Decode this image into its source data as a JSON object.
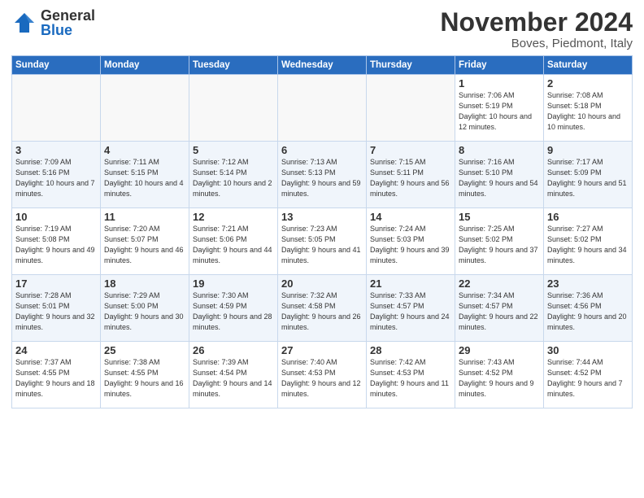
{
  "logo": {
    "general": "General",
    "blue": "Blue"
  },
  "header": {
    "month": "November 2024",
    "location": "Boves, Piedmont, Italy"
  },
  "weekdays": [
    "Sunday",
    "Monday",
    "Tuesday",
    "Wednesday",
    "Thursday",
    "Friday",
    "Saturday"
  ],
  "weeks": [
    [
      {
        "day": "",
        "info": ""
      },
      {
        "day": "",
        "info": ""
      },
      {
        "day": "",
        "info": ""
      },
      {
        "day": "",
        "info": ""
      },
      {
        "day": "",
        "info": ""
      },
      {
        "day": "1",
        "info": "Sunrise: 7:06 AM\nSunset: 5:19 PM\nDaylight: 10 hours and 12 minutes."
      },
      {
        "day": "2",
        "info": "Sunrise: 7:08 AM\nSunset: 5:18 PM\nDaylight: 10 hours and 10 minutes."
      }
    ],
    [
      {
        "day": "3",
        "info": "Sunrise: 7:09 AM\nSunset: 5:16 PM\nDaylight: 10 hours and 7 minutes."
      },
      {
        "day": "4",
        "info": "Sunrise: 7:11 AM\nSunset: 5:15 PM\nDaylight: 10 hours and 4 minutes."
      },
      {
        "day": "5",
        "info": "Sunrise: 7:12 AM\nSunset: 5:14 PM\nDaylight: 10 hours and 2 minutes."
      },
      {
        "day": "6",
        "info": "Sunrise: 7:13 AM\nSunset: 5:13 PM\nDaylight: 9 hours and 59 minutes."
      },
      {
        "day": "7",
        "info": "Sunrise: 7:15 AM\nSunset: 5:11 PM\nDaylight: 9 hours and 56 minutes."
      },
      {
        "day": "8",
        "info": "Sunrise: 7:16 AM\nSunset: 5:10 PM\nDaylight: 9 hours and 54 minutes."
      },
      {
        "day": "9",
        "info": "Sunrise: 7:17 AM\nSunset: 5:09 PM\nDaylight: 9 hours and 51 minutes."
      }
    ],
    [
      {
        "day": "10",
        "info": "Sunrise: 7:19 AM\nSunset: 5:08 PM\nDaylight: 9 hours and 49 minutes."
      },
      {
        "day": "11",
        "info": "Sunrise: 7:20 AM\nSunset: 5:07 PM\nDaylight: 9 hours and 46 minutes."
      },
      {
        "day": "12",
        "info": "Sunrise: 7:21 AM\nSunset: 5:06 PM\nDaylight: 9 hours and 44 minutes."
      },
      {
        "day": "13",
        "info": "Sunrise: 7:23 AM\nSunset: 5:05 PM\nDaylight: 9 hours and 41 minutes."
      },
      {
        "day": "14",
        "info": "Sunrise: 7:24 AM\nSunset: 5:03 PM\nDaylight: 9 hours and 39 minutes."
      },
      {
        "day": "15",
        "info": "Sunrise: 7:25 AM\nSunset: 5:02 PM\nDaylight: 9 hours and 37 minutes."
      },
      {
        "day": "16",
        "info": "Sunrise: 7:27 AM\nSunset: 5:02 PM\nDaylight: 9 hours and 34 minutes."
      }
    ],
    [
      {
        "day": "17",
        "info": "Sunrise: 7:28 AM\nSunset: 5:01 PM\nDaylight: 9 hours and 32 minutes."
      },
      {
        "day": "18",
        "info": "Sunrise: 7:29 AM\nSunset: 5:00 PM\nDaylight: 9 hours and 30 minutes."
      },
      {
        "day": "19",
        "info": "Sunrise: 7:30 AM\nSunset: 4:59 PM\nDaylight: 9 hours and 28 minutes."
      },
      {
        "day": "20",
        "info": "Sunrise: 7:32 AM\nSunset: 4:58 PM\nDaylight: 9 hours and 26 minutes."
      },
      {
        "day": "21",
        "info": "Sunrise: 7:33 AM\nSunset: 4:57 PM\nDaylight: 9 hours and 24 minutes."
      },
      {
        "day": "22",
        "info": "Sunrise: 7:34 AM\nSunset: 4:57 PM\nDaylight: 9 hours and 22 minutes."
      },
      {
        "day": "23",
        "info": "Sunrise: 7:36 AM\nSunset: 4:56 PM\nDaylight: 9 hours and 20 minutes."
      }
    ],
    [
      {
        "day": "24",
        "info": "Sunrise: 7:37 AM\nSunset: 4:55 PM\nDaylight: 9 hours and 18 minutes."
      },
      {
        "day": "25",
        "info": "Sunrise: 7:38 AM\nSunset: 4:55 PM\nDaylight: 9 hours and 16 minutes."
      },
      {
        "day": "26",
        "info": "Sunrise: 7:39 AM\nSunset: 4:54 PM\nDaylight: 9 hours and 14 minutes."
      },
      {
        "day": "27",
        "info": "Sunrise: 7:40 AM\nSunset: 4:53 PM\nDaylight: 9 hours and 12 minutes."
      },
      {
        "day": "28",
        "info": "Sunrise: 7:42 AM\nSunset: 4:53 PM\nDaylight: 9 hours and 11 minutes."
      },
      {
        "day": "29",
        "info": "Sunrise: 7:43 AM\nSunset: 4:52 PM\nDaylight: 9 hours and 9 minutes."
      },
      {
        "day": "30",
        "info": "Sunrise: 7:44 AM\nSunset: 4:52 PM\nDaylight: 9 hours and 7 minutes."
      }
    ]
  ]
}
